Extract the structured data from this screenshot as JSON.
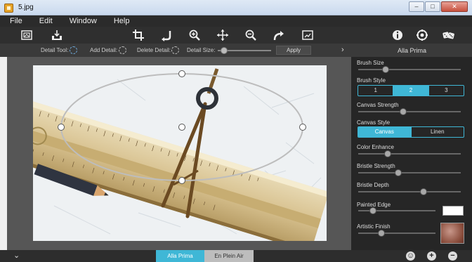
{
  "window": {
    "title": "5.jpg",
    "controls": [
      "–",
      "□",
      "✕"
    ]
  },
  "menu": [
    "File",
    "Edit",
    "Window",
    "Help"
  ],
  "toolbar": {
    "icons": [
      "open-image-icon",
      "save-icon",
      "crop-icon",
      "rotate-icon",
      "zoom-in-icon",
      "move-icon",
      "zoom-out-icon",
      "redo-icon",
      "export-icon",
      "info-icon",
      "settings-icon",
      "random-dice-icon"
    ]
  },
  "options": {
    "detail_tool": "Detail Tool:",
    "add_detail": "Add Detail:",
    "delete_detail": "Delete Detail:",
    "detail_size": "Detail Size:",
    "detail_size_value": 0.02,
    "apply": "Apply"
  },
  "panel": {
    "title": "Alla Prima",
    "controls": [
      {
        "label": "Brush Size",
        "value": 0.27
      },
      {
        "label": "Brush Style",
        "options": [
          "1",
          "2",
          "3"
        ],
        "selected": "2"
      },
      {
        "label": "Canvas Strength",
        "value": 0.44
      },
      {
        "label": "Canvas Style",
        "options": [
          "Canvas",
          "Linen"
        ],
        "selected": "Canvas"
      },
      {
        "label": "Color Enhance",
        "value": 0.29
      },
      {
        "label": "Bristle Strength",
        "value": 0.39
      },
      {
        "label": "Bristle Depth",
        "value": 0.64
      },
      {
        "label": "Painted Edge",
        "value": 0.19,
        "color": "#ffffff"
      },
      {
        "label": "Artistic Finish",
        "value": 0.3
      }
    ]
  },
  "bottom": {
    "tabs": [
      "Alla Prima",
      "En Plein Air"
    ],
    "active_tab": "Alla Prima"
  },
  "colors": {
    "accent": "#3fb7d6",
    "panel_bg": "#262626",
    "workspace_bg": "#565656"
  }
}
